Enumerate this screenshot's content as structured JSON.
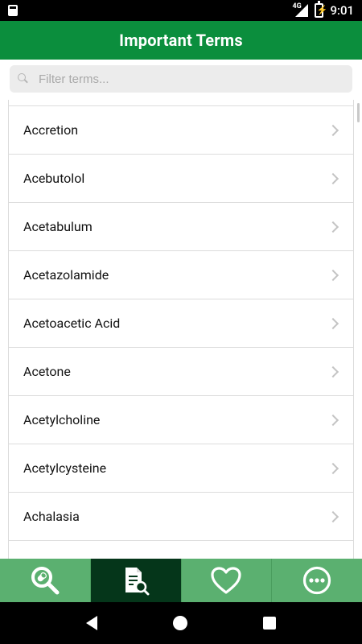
{
  "status_bar": {
    "time": "9:01",
    "network": "4G"
  },
  "app_bar": {
    "title": "Important Terms"
  },
  "search": {
    "placeholder": "Filter terms..."
  },
  "terms": [
    "Accretion",
    "Acebutolol",
    "Acetabulum",
    "Acetazolamide",
    "Acetoacetic Acid",
    "Acetone",
    "Acetylcholine",
    "Acetylcysteine",
    "Achalasia"
  ],
  "tabs": [
    {
      "icon": "pill-search-icon",
      "active": false
    },
    {
      "icon": "document-search-icon",
      "active": true
    },
    {
      "icon": "heart-icon",
      "active": false
    },
    {
      "icon": "more-icon",
      "active": false
    }
  ],
  "colors": {
    "primary": "#0b8e3d",
    "tab": "#5bb070",
    "tab_active": "#05361a"
  }
}
